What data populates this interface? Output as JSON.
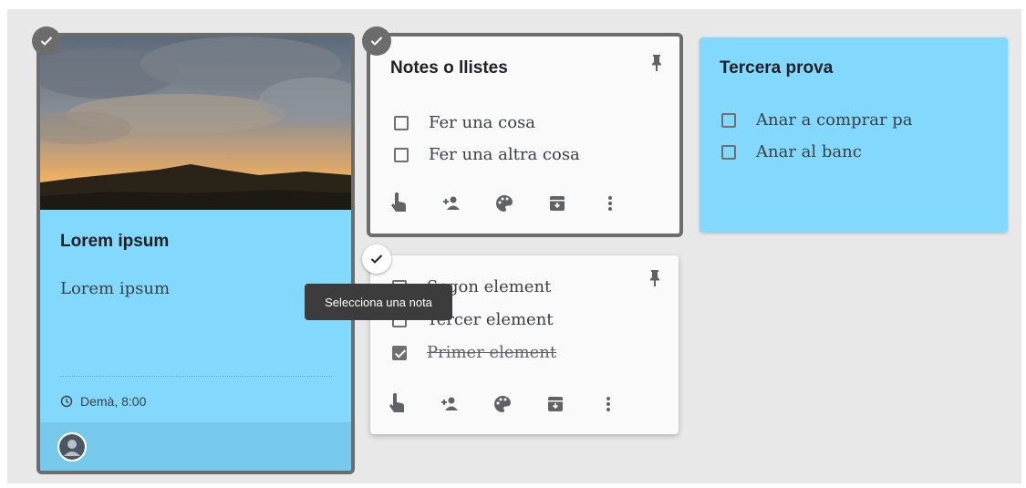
{
  "colors": {
    "board": "#e8e8e8",
    "note_blue": "#82d8fd",
    "note_white": "#fafafa",
    "selected_border": "#6c6c6c",
    "tooltip": "#3c3c3c"
  },
  "notes": [
    {
      "id": "lorem",
      "title": "Lorem ipsum",
      "body": "Lorem ipsum",
      "reminder": "Demà, 8:00",
      "selected": true,
      "has_image": true
    },
    {
      "id": "notes-llistes",
      "title": "Notes o llistes",
      "pinned": true,
      "selected": true,
      "items": [
        {
          "text": "Fer una cosa",
          "checked": false
        },
        {
          "text": "Fer una altra cosa",
          "checked": false
        }
      ]
    },
    {
      "id": "elements",
      "title": "",
      "pinned": true,
      "selected": false,
      "items": [
        {
          "text": "Segon element",
          "checked": false
        },
        {
          "text": "Tercer element",
          "checked": false
        },
        {
          "text": "Primer element",
          "checked": true
        }
      ]
    },
    {
      "id": "tercera",
      "title": "Tercera prova",
      "selected": false,
      "items": [
        {
          "text": "Anar a comprar pa",
          "checked": false
        },
        {
          "text": "Anar al banc",
          "checked": false
        }
      ]
    }
  ],
  "toolbar_icons": [
    "touch-icon",
    "add-collaborator-icon",
    "palette-icon",
    "archive-icon",
    "more-vert-icon"
  ],
  "tooltip": {
    "text": "Selecciona una nota"
  }
}
